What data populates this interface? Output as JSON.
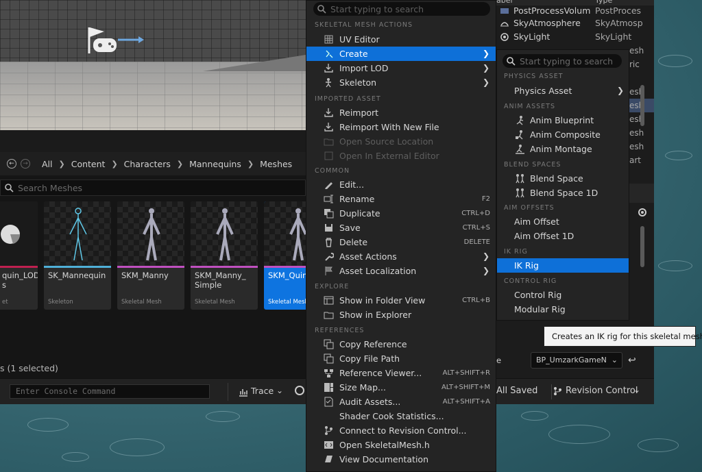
{
  "content_browser": {
    "breadcrumb": [
      "All",
      "Content",
      "Characters",
      "Mannequins",
      "Meshes"
    ],
    "search_placeholder": "Search Meshes",
    "assets": [
      {
        "name": "quin_LOD s",
        "type": "et",
        "color": "#c02050"
      },
      {
        "name": "SK_Mannequin",
        "type": "Skeleton",
        "color": "#4fb0d8"
      },
      {
        "name": "SKM_Manny",
        "type": "Skeletal Mesh",
        "color": "#c050c0"
      },
      {
        "name": "SKM_Manny_ Simple",
        "type": "Skeletal Mesh",
        "color": "#c050c0"
      },
      {
        "name": "SKM_Quinn",
        "type": "Skeletal Mesh",
        "color": "#c050c0"
      }
    ],
    "selection_status": "s (1 selected)"
  },
  "console": {
    "placeholder": "Enter Console Command",
    "trace_label": "Trace"
  },
  "outliner": {
    "header_label": "abel",
    "header_type": "Type",
    "rows": [
      {
        "label": "PostProcessVolum",
        "type": "PostProces"
      },
      {
        "label": "SkyAtmosphere",
        "type": "SkyAtmosp"
      },
      {
        "label": "SkyLight",
        "type": "SkyLight"
      }
    ],
    "partial_types": [
      "esh",
      "ric",
      "esh",
      "esh",
      "esh",
      "esh",
      "esh",
      "art"
    ]
  },
  "right_bottom": {
    "all_saved": "All Saved",
    "revision_control": "Revision Control",
    "game_mode_value": "BP_UmzarkGameN",
    "game_mode_prefix": "e"
  },
  "context_menu": {
    "search_placeholder": "Start typing to search",
    "sections": {
      "skeletal": "SKELETAL MESH ACTIONS",
      "imported": "IMPORTED ASSET",
      "common": "COMMON",
      "explore": "EXPLORE",
      "references": "REFERENCES"
    },
    "items": {
      "uv_editor": "UV Editor",
      "create": "Create",
      "import_lod": "Import LOD",
      "skeleton": "Skeleton",
      "reimport": "Reimport",
      "reimport_new": "Reimport With New File",
      "open_source": "Open Source Location",
      "open_external": "Open In External Editor",
      "edit": "Edit...",
      "rename": "Rename",
      "duplicate": "Duplicate",
      "save": "Save",
      "delete": "Delete",
      "asset_actions": "Asset Actions",
      "asset_localization": "Asset Localization",
      "show_folder": "Show in Folder View",
      "show_explorer": "Show in Explorer",
      "copy_reference": "Copy Reference",
      "copy_file_path": "Copy File Path",
      "reference_viewer": "Reference Viewer...",
      "size_map": "Size Map...",
      "audit_assets": "Audit Assets...",
      "shader_cook": "Shader Cook Statistics...",
      "connect_rc": "Connect to Revision Control...",
      "open_header": "Open SkeletalMesh.h",
      "view_docs": "View Documentation"
    },
    "shortcuts": {
      "rename": "F2",
      "duplicate": "CTRL+D",
      "save": "CTRL+S",
      "delete": "DELETE",
      "show_folder": "CTRL+B",
      "reference_viewer": "ALT+SHIFT+R",
      "size_map": "ALT+SHIFT+M",
      "audit_assets": "ALT+SHIFT+A"
    }
  },
  "submenu": {
    "search_placeholder": "Start typing to search",
    "sections": {
      "physics": "PHYSICS ASSET",
      "anim": "ANIM ASSETS",
      "blend": "BLEND SPACES",
      "aim": "AIM OFFSETS",
      "ikrig": "IK RIG",
      "control": "CONTROL RIG"
    },
    "items": {
      "physics_asset": "Physics Asset",
      "anim_blueprint": "Anim Blueprint",
      "anim_composite": "Anim Composite",
      "anim_montage": "Anim Montage",
      "blend_space": "Blend Space",
      "blend_space_1d": "Blend Space 1D",
      "aim_offset": "Aim Offset",
      "aim_offset_1d": "Aim Offset 1D",
      "ik_rig": "IK Rig",
      "control_rig": "Control Rig",
      "modular_rig": "Modular Rig"
    }
  },
  "tooltip": {
    "text": "Creates an IK rig for this skeletal mesh."
  },
  "colors": {
    "highlight": "#0e70d8",
    "menu_bg": "#242424"
  }
}
